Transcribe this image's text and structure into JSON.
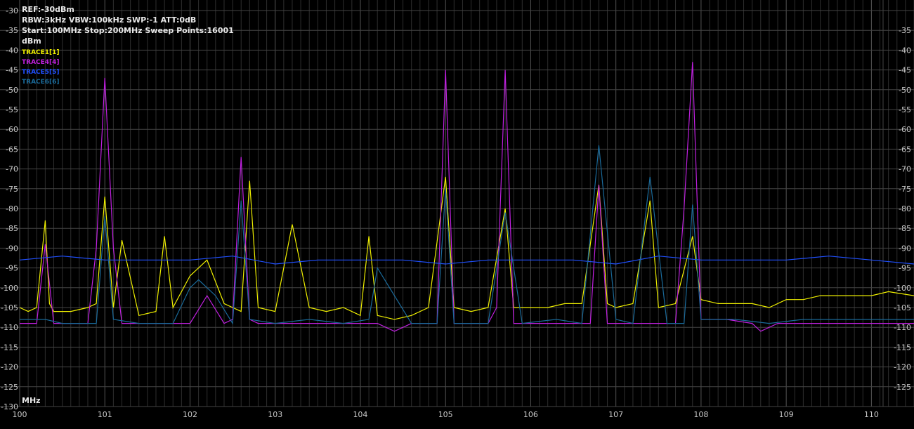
{
  "header": {
    "ref": "REF:-30dBm",
    "settings": "RBW:3kHz VBW:100kHz SWP:-1 ATT:0dB",
    "span": "Start:100MHz Stop:200MHz Sweep Points:16001",
    "y_unit": "dBm"
  },
  "x_unit_label": "MHz",
  "legend": [
    {
      "label": "TRACE1[1]",
      "color": "#f0f000"
    },
    {
      "label": "TRACE4[4]",
      "color": "#c020e0"
    },
    {
      "label": "TRACE5[5]",
      "color": "#2050ff"
    },
    {
      "label": "TRACE6[6]",
      "color": "#1a6a9a"
    }
  ],
  "colors": {
    "background": "#000000",
    "grid": "#3a3a3a",
    "axis_text": "#c8c8c8"
  },
  "chart_data": {
    "type": "line",
    "xlim": [
      100,
      110.5
    ],
    "ylim": [
      -130,
      -30
    ],
    "x_ticks": [
      "100",
      "101",
      "102",
      "103",
      "104",
      "105",
      "106",
      "107",
      "108",
      "109",
      "110"
    ],
    "y_ticks_left": [
      "-30",
      "-35",
      "-40",
      "-45",
      "-50",
      "-55",
      "-60",
      "-65",
      "-70",
      "-75",
      "-80",
      "-85",
      "-90",
      "-95",
      "-100",
      "-105",
      "-110",
      "-115",
      "-120",
      "-125",
      "-130"
    ],
    "y_ticks_right": [
      "-35",
      "-40",
      "-45",
      "-50",
      "-55",
      "-60",
      "-65",
      "-70",
      "-75",
      "-80",
      "-85",
      "-90",
      "-95",
      "-100",
      "-105",
      "-110",
      "-115",
      "-120",
      "-125"
    ],
    "grid": true,
    "series": [
      {
        "name": "TRACE1[1]",
        "color": "#f0f000",
        "x": [
          100,
          100.1,
          100.2,
          100.3,
          100.35,
          100.4,
          100.6,
          100.8,
          100.9,
          101.0,
          101.1,
          101.2,
          101.4,
          101.6,
          101.7,
          101.8,
          102.0,
          102.2,
          102.4,
          102.6,
          102.7,
          102.8,
          103.0,
          103.2,
          103.4,
          103.6,
          103.8,
          104.0,
          104.1,
          104.2,
          104.4,
          104.6,
          104.8,
          105.0,
          105.1,
          105.3,
          105.5,
          105.7,
          105.8,
          106.0,
          106.2,
          106.4,
          106.6,
          106.8,
          106.9,
          107.0,
          107.2,
          107.4,
          107.5,
          107.7,
          107.9,
          108.0,
          108.2,
          108.4,
          108.6,
          108.8,
          109.0,
          109.2,
          109.4,
          109.6,
          109.8,
          110.0,
          110.2,
          110.5
        ],
        "y": [
          -105,
          -106,
          -105,
          -83,
          -104,
          -106,
          -106,
          -105,
          -104,
          -77,
          -105,
          -88,
          -107,
          -106,
          -87,
          -105,
          -97,
          -93,
          -104,
          -106,
          -73,
          -105,
          -106,
          -84,
          -105,
          -106,
          -105,
          -107,
          -87,
          -107,
          -108,
          -107,
          -105,
          -72,
          -105,
          -106,
          -105,
          -80,
          -105,
          -105,
          -105,
          -104,
          -104,
          -74,
          -104,
          -105,
          -104,
          -78,
          -105,
          -104,
          -87,
          -103,
          -104,
          -104,
          -104,
          -105,
          -103,
          -103,
          -102,
          -102,
          -102,
          -102,
          -101,
          -102
        ]
      },
      {
        "name": "TRACE4[4]",
        "color": "#c020e0",
        "x": [
          100,
          100.2,
          100.3,
          100.4,
          100.6,
          100.8,
          100.9,
          101.0,
          101.1,
          101.2,
          101.4,
          101.6,
          101.8,
          102.0,
          102.2,
          102.4,
          102.5,
          102.6,
          102.7,
          102.8,
          103.0,
          103.4,
          103.8,
          104.0,
          104.2,
          104.4,
          104.6,
          104.8,
          104.9,
          105.0,
          105.1,
          105.3,
          105.5,
          105.6,
          105.7,
          105.8,
          106.0,
          106.4,
          106.7,
          106.8,
          106.9,
          107.2,
          107.5,
          107.7,
          107.8,
          107.9,
          108.0,
          108.3,
          108.6,
          108.7,
          108.9,
          109.2,
          109.6,
          110.0,
          110.5
        ],
        "y": [
          -109,
          -109,
          -89,
          -109,
          -109,
          -109,
          -90,
          -47,
          -90,
          -109,
          -109,
          -109,
          -109,
          -109,
          -102,
          -109,
          -108,
          -67,
          -108,
          -109,
          -109,
          -109,
          -109,
          -109,
          -109,
          -111,
          -109,
          -109,
          -109,
          -45,
          -109,
          -109,
          -109,
          -105,
          -45,
          -109,
          -109,
          -109,
          -109,
          -74,
          -109,
          -109,
          -109,
          -109,
          -80,
          -43,
          -108,
          -108,
          -109,
          -111,
          -109,
          -109,
          -109,
          -109,
          -109
        ]
      },
      {
        "name": "TRACE5[5]",
        "color": "#2050ff",
        "x": [
          100,
          100.5,
          101,
          101.5,
          102,
          102.5,
          103,
          103.5,
          104,
          104.5,
          105,
          105.5,
          106,
          106.5,
          107,
          107.5,
          108,
          108.5,
          109,
          109.5,
          110,
          110.5
        ],
        "y": [
          -93,
          -92,
          -93,
          -93,
          -93,
          -92,
          -94,
          -93,
          -93,
          -93,
          -94,
          -93,
          -93,
          -93,
          -94,
          -92,
          -93,
          -93,
          -93,
          -92,
          -93,
          -94
        ]
      },
      {
        "name": "TRACE6[6]",
        "color": "#1a6a9a",
        "x": [
          100,
          100.3,
          100.5,
          100.9,
          101.0,
          101.1,
          101.4,
          101.8,
          102.0,
          102.1,
          102.3,
          102.5,
          102.6,
          102.7,
          103.0,
          103.4,
          103.8,
          104.1,
          104.2,
          104.6,
          104.9,
          105.0,
          105.1,
          105.5,
          105.7,
          105.9,
          106.3,
          106.6,
          106.8,
          107.0,
          107.2,
          107.4,
          107.6,
          107.8,
          107.9,
          108.0,
          108.4,
          108.8,
          109.2,
          109.6,
          110.0,
          110.5
        ],
        "y": [
          -108,
          -108,
          -109,
          -109,
          -82,
          -108,
          -109,
          -109,
          -100,
          -98,
          -102,
          -109,
          -78,
          -108,
          -109,
          -108,
          -109,
          -108,
          -95,
          -109,
          -109,
          -75,
          -109,
          -109,
          -81,
          -109,
          -108,
          -109,
          -64,
          -108,
          -109,
          -72,
          -109,
          -109,
          -79,
          -108,
          -108,
          -109,
          -108,
          -108,
          -108,
          -108
        ]
      }
    ]
  }
}
